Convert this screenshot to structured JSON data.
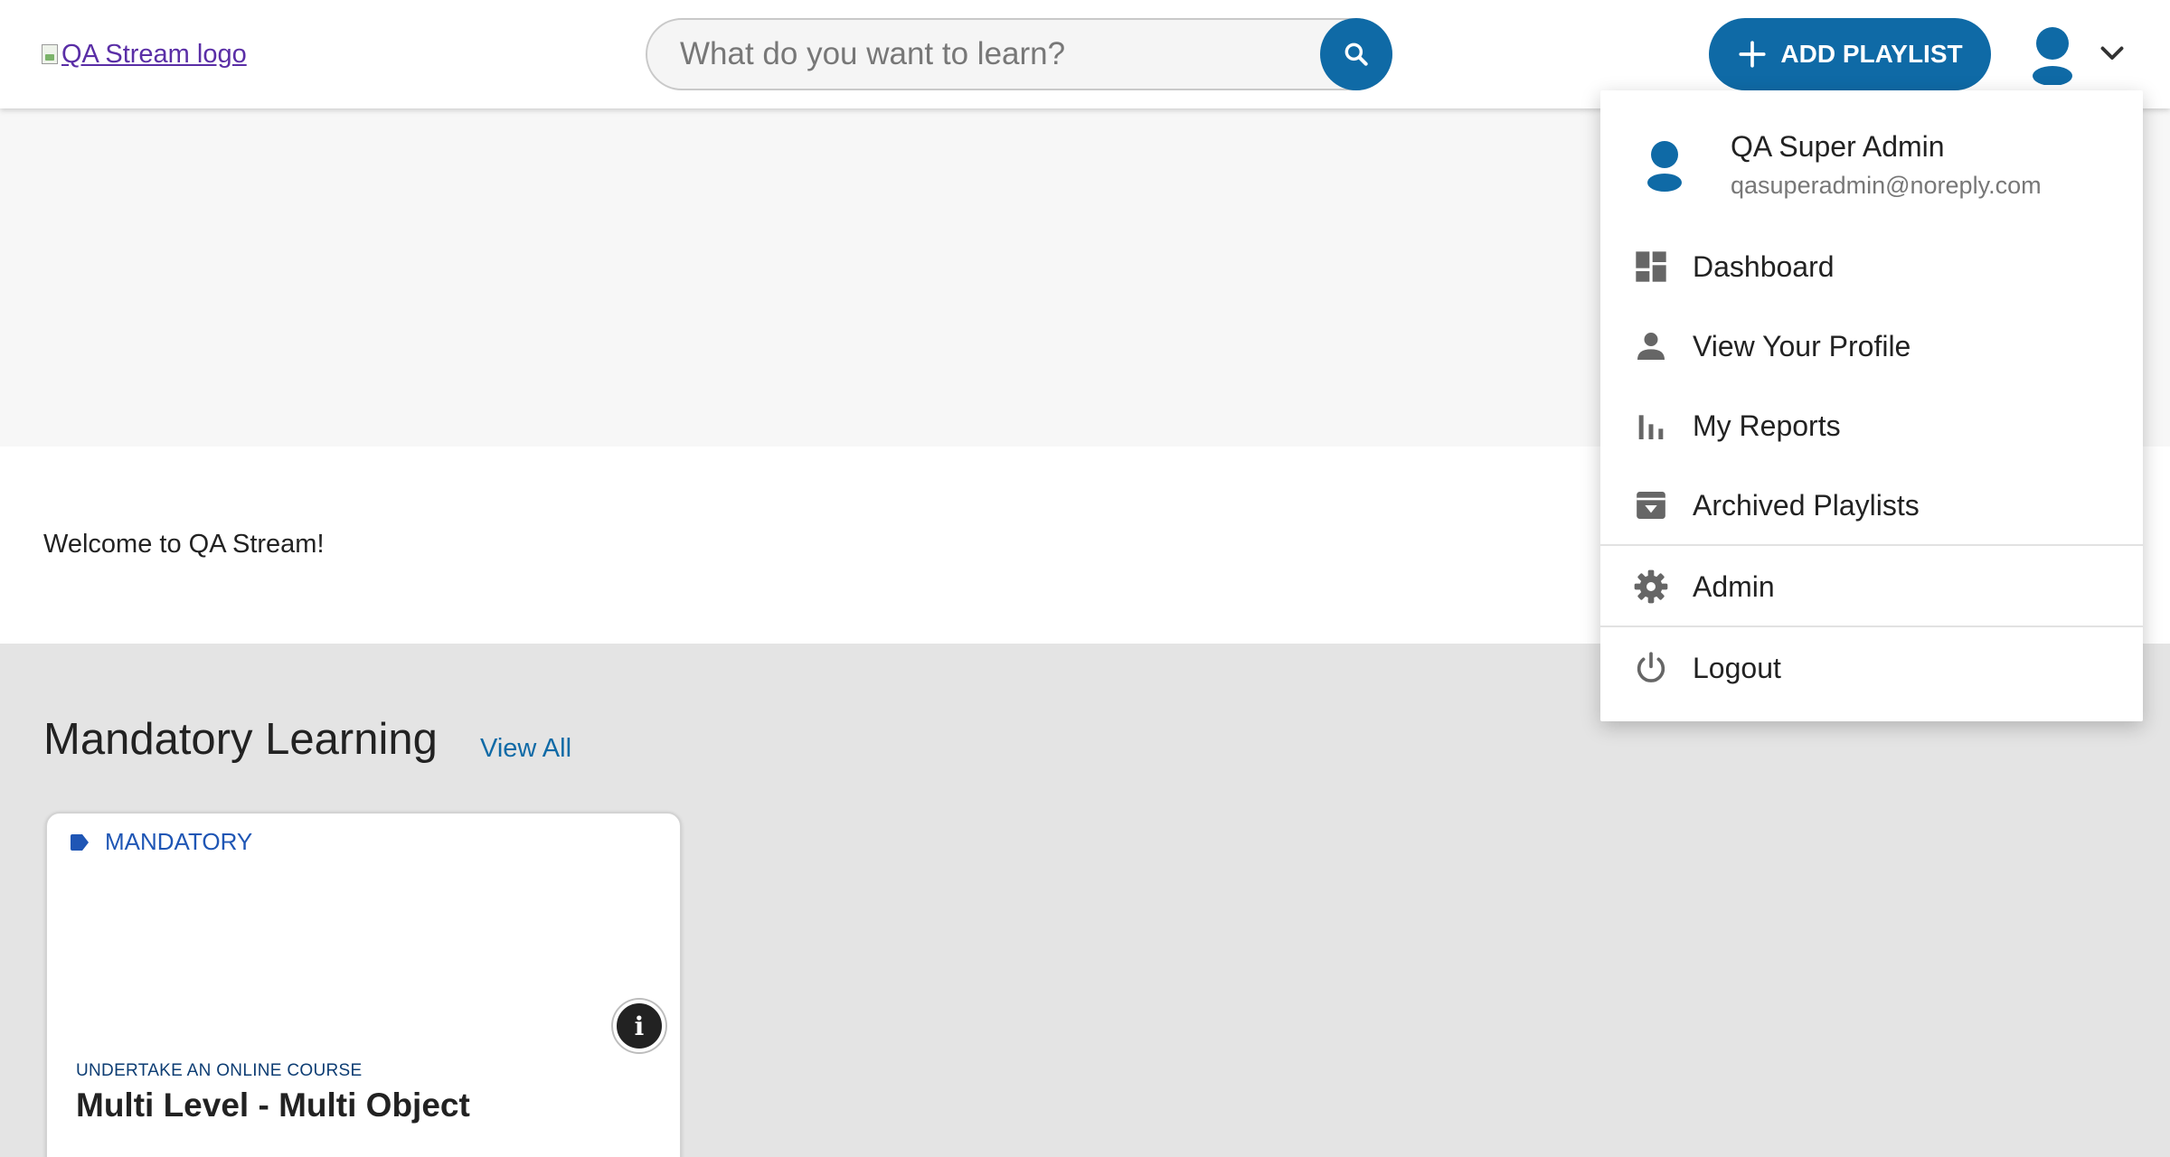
{
  "header": {
    "logo_alt": "QA Stream logo",
    "search_placeholder": "What do you want to learn?",
    "add_playlist_label": "ADD PLAYLIST"
  },
  "main": {
    "welcome": "Welcome to QA Stream!",
    "section_title": "Mandatory Learning",
    "view_all": "View All",
    "card": {
      "tag": "MANDATORY",
      "kicker": "UNDERTAKE AN ONLINE COURSE",
      "title": "Multi Level - Multi Object",
      "info_glyph": "i"
    }
  },
  "user_menu": {
    "name": "QA Super Admin",
    "email": "qasuperadmin@noreply.com",
    "items": [
      {
        "label": "Dashboard",
        "icon": "dashboard-icon"
      },
      {
        "label": "View Your Profile",
        "icon": "person-icon"
      },
      {
        "label": "My Reports",
        "icon": "bar-chart-icon"
      },
      {
        "label": "Archived Playlists",
        "icon": "archive-icon"
      },
      {
        "label": "Admin",
        "icon": "gear-icon"
      },
      {
        "label": "Logout",
        "icon": "power-icon"
      }
    ]
  },
  "colors": {
    "primary": "#0f6aa6",
    "tag_blue": "#1f56b5",
    "section_bg": "#e4e4e4",
    "banner_bg": "#f7f7f7"
  }
}
